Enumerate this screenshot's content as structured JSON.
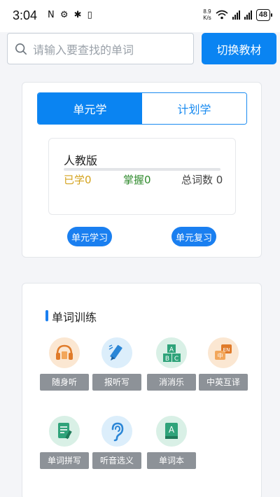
{
  "status_bar": {
    "time": "3:04",
    "indicators": "N ⚙ ✱ ▯",
    "speed_value": "8.9",
    "speed_unit": "K/s",
    "battery": "48"
  },
  "search": {
    "placeholder": "请输入要查找的单词",
    "icon": "search-icon"
  },
  "switch_button": "切换教材",
  "study": {
    "tabs": [
      {
        "label": "单元学",
        "active": true
      },
      {
        "label": "计划学",
        "active": false
      }
    ],
    "book": {
      "title": "人教版",
      "progress": 0,
      "learned": "已学0",
      "mastered": "掌握0",
      "total": "总词数 0"
    },
    "buttons": {
      "unit_study": "单元学习",
      "unit_review": "单元复习"
    }
  },
  "training": {
    "title": "单词训练",
    "tools": [
      {
        "label": "随身听",
        "icon": "headphones-icon"
      },
      {
        "label": "报听写",
        "icon": "pencil-icon"
      },
      {
        "label": "消消乐",
        "icon": "abc-blocks-icon"
      },
      {
        "label": "中英互译",
        "icon": "translate-icon"
      },
      {
        "label": "单词拼写",
        "icon": "document-pen-icon"
      },
      {
        "label": "听音选义",
        "icon": "ear-icon"
      },
      {
        "label": "单词本",
        "icon": "word-book-icon"
      }
    ]
  },
  "colors": {
    "accent": "#0a84f2",
    "learned": "#d4a31e",
    "mastered": "#2f8a2c"
  }
}
